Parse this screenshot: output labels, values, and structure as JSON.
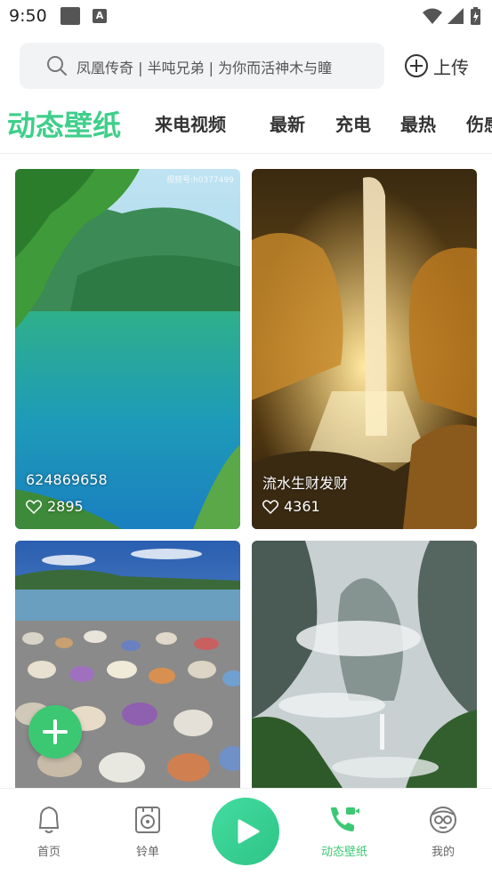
{
  "status_bar": {
    "time": "9:50",
    "notification_icon_letter": "A"
  },
  "search": {
    "placeholder": "凤凰传奇 | 半吨兄弟 | 为你而活神木与瞳"
  },
  "upload": {
    "label": "上传"
  },
  "tabs": [
    {
      "label": "动态壁纸",
      "active": true
    },
    {
      "label": "来电视频"
    },
    {
      "label": "最新"
    },
    {
      "label": "充电"
    },
    {
      "label": "最热"
    },
    {
      "label": "伤感"
    }
  ],
  "cards": [
    {
      "title": "624869658",
      "likes": "2895",
      "watermark": "视频号:h0377499"
    },
    {
      "title": "流水生财发财",
      "likes": "4361"
    },
    {
      "title": "",
      "likes": ""
    },
    {
      "title": "",
      "likes": ""
    }
  ],
  "bottom_nav": {
    "home": "首页",
    "ringtones": "铃单",
    "live_wallpaper": "动态壁纸",
    "mine": "我的"
  },
  "colors": {
    "accent": "#3cc873",
    "tab_active": "#3fcf8a"
  }
}
